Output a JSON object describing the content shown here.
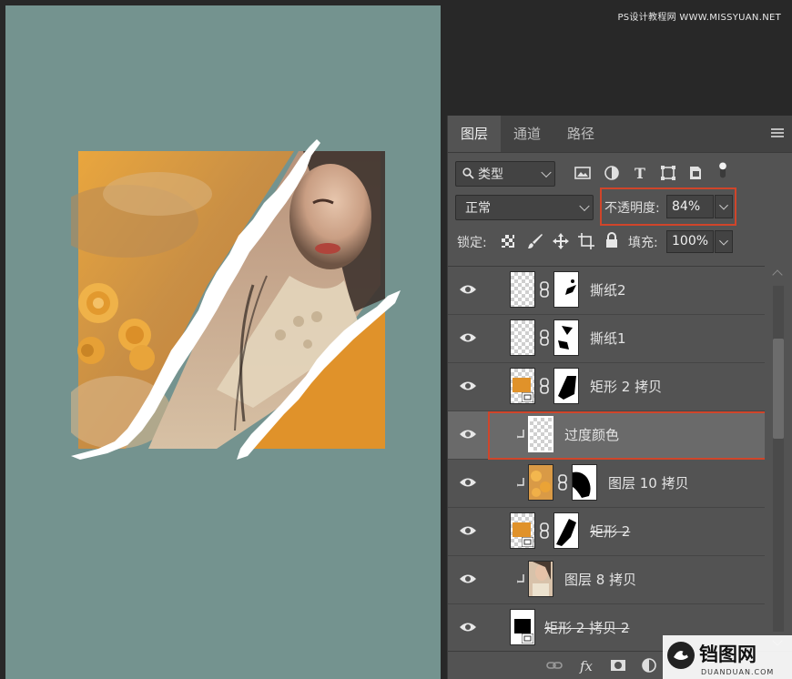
{
  "watermark_top": "PS设计教程网 WWW.MISSYUAN.NET",
  "panel": {
    "tabs": [
      {
        "label": "图层",
        "active": true
      },
      {
        "label": "通道",
        "active": false
      },
      {
        "label": "路径",
        "active": false
      }
    ],
    "filter": {
      "kind_label": "类型"
    },
    "blend_mode": "正常",
    "opacity_label": "不透明度:",
    "opacity_value": "84%",
    "lock_label": "锁定:",
    "fill_label": "填充:",
    "fill_value": "100%"
  },
  "layers": [
    {
      "name": "撕纸2",
      "visible": true,
      "clipped": false,
      "thumb": "transparent",
      "has_mask": true,
      "mask": "spots",
      "struck": false,
      "selected": false
    },
    {
      "name": "撕纸1",
      "visible": true,
      "clipped": false,
      "thumb": "transparent",
      "has_mask": true,
      "mask": "blobs",
      "struck": false,
      "selected": false
    },
    {
      "name": "矩形 2 拷贝",
      "visible": true,
      "clipped": false,
      "thumb": "orange-smart",
      "has_mask": true,
      "mask": "blob-big",
      "struck": false,
      "selected": false
    },
    {
      "name": "过度颜色",
      "visible": true,
      "clipped": true,
      "thumb": "transparent",
      "has_mask": false,
      "struck": false,
      "selected": true
    },
    {
      "name": "图层 10 拷贝",
      "visible": true,
      "clipped": true,
      "thumb": "flowers",
      "has_mask": true,
      "mask": "portrait",
      "struck": false,
      "selected": false
    },
    {
      "name": "矩形 2",
      "visible": true,
      "clipped": false,
      "thumb": "orange-smart",
      "has_mask": true,
      "mask": "blob-diag",
      "struck": true,
      "selected": false
    },
    {
      "name": "图层 8 拷贝",
      "visible": true,
      "clipped": true,
      "thumb": "photo",
      "has_mask": false,
      "struck": false,
      "selected": false
    },
    {
      "name": "矩形 2 拷贝 2",
      "visible": true,
      "clipped": false,
      "thumb": "black-smart",
      "has_mask": false,
      "struck": true,
      "selected": false
    }
  ],
  "logo": {
    "main": "铛图网",
    "sub": "DUANDUAN.COM"
  },
  "colors": {
    "canvas_bg": "#74938f",
    "orange": "#e09a2a",
    "highlight": "#d0452a"
  }
}
